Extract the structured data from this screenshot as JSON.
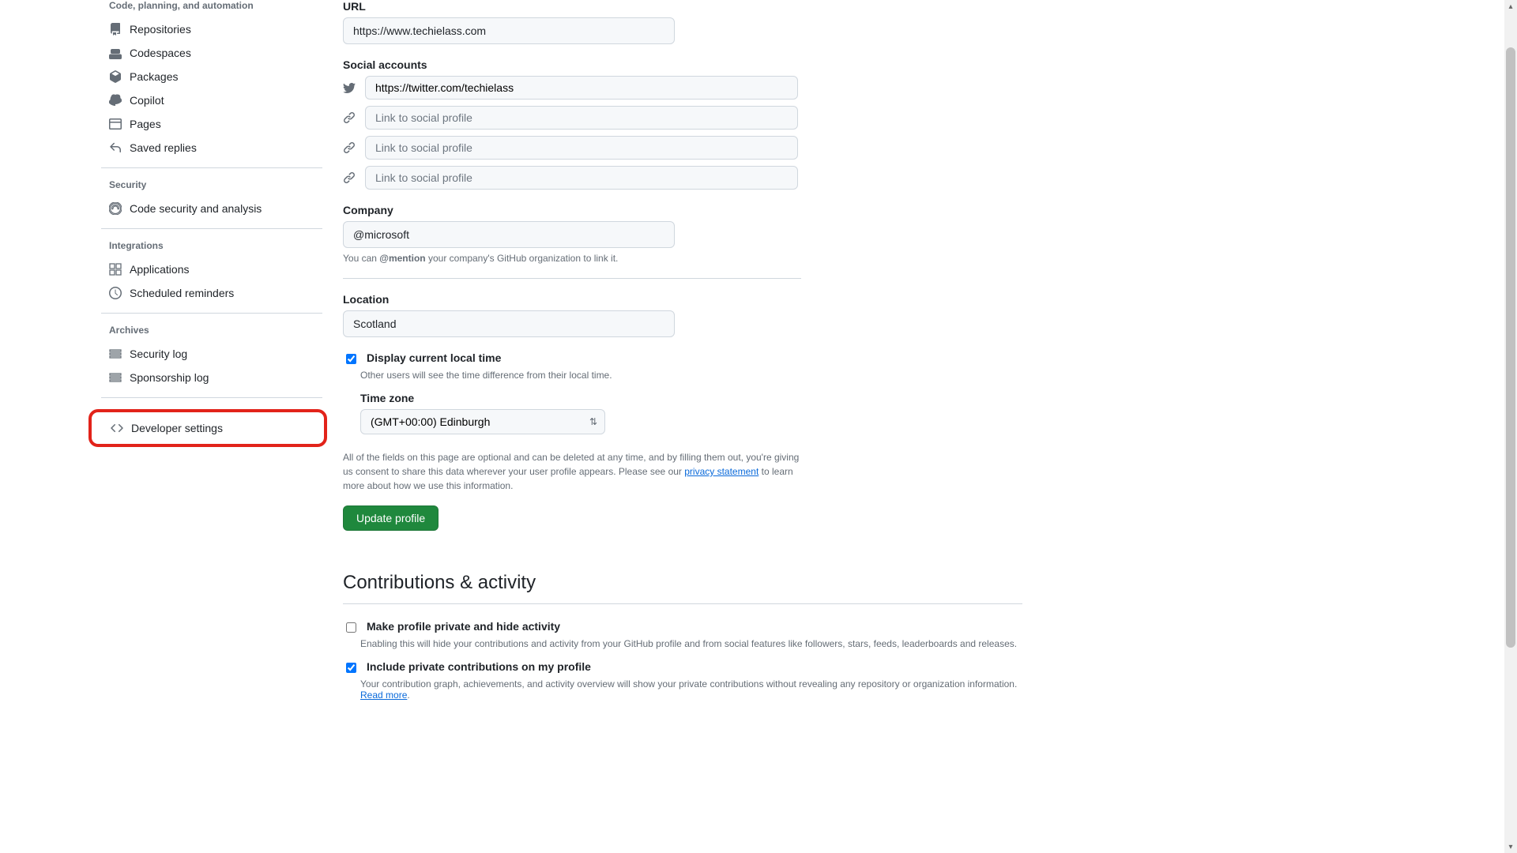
{
  "sidebar": {
    "group_code": "Code, planning, and automation",
    "items_code": [
      {
        "label": "Repositories"
      },
      {
        "label": "Codespaces"
      },
      {
        "label": "Packages"
      },
      {
        "label": "Copilot"
      },
      {
        "label": "Pages"
      },
      {
        "label": "Saved replies"
      }
    ],
    "group_security": "Security",
    "items_security": [
      {
        "label": "Code security and analysis"
      }
    ],
    "group_integrations": "Integrations",
    "items_integrations": [
      {
        "label": "Applications"
      },
      {
        "label": "Scheduled reminders"
      }
    ],
    "group_archives": "Archives",
    "items_archives": [
      {
        "label": "Security log"
      },
      {
        "label": "Sponsorship log"
      }
    ],
    "developer_settings": "Developer settings"
  },
  "form": {
    "url_label": "URL",
    "url_value": "https://www.techielass.com",
    "social_label": "Social accounts",
    "social_value_1": "https://twitter.com/techielass",
    "social_placeholder": "Link to social profile",
    "company_label": "Company",
    "company_value": "@microsoft",
    "company_help_pre": "You can ",
    "company_help_bold": "@mention",
    "company_help_post": " your company's GitHub organization to link it.",
    "location_label": "Location",
    "location_value": "Scotland",
    "display_time_label": "Display current local time",
    "display_time_desc": "Other users will see the time difference from their local time.",
    "timezone_label": "Time zone",
    "timezone_value": "(GMT+00:00) Edinburgh",
    "disclaimer_pre": "All of the fields on this page are optional and can be deleted at any time, and by filling them out, you're giving us consent to share this data wherever your user profile appears. Please see our ",
    "disclaimer_link": "privacy statement",
    "disclaimer_post": " to learn more about how we use this information.",
    "update_btn": "Update profile"
  },
  "contributions": {
    "heading": "Contributions & activity",
    "private_label": "Make profile private and hide activity",
    "private_desc": "Enabling this will hide your contributions and activity from your GitHub profile and from social features like followers, stars, feeds, leaderboards and releases.",
    "include_label": "Include private contributions on my profile",
    "include_desc_pre": "Your contribution graph, achievements, and activity overview will show your private contributions without revealing any repository or organization information. ",
    "include_desc_link": "Read more",
    "include_desc_post": "."
  }
}
